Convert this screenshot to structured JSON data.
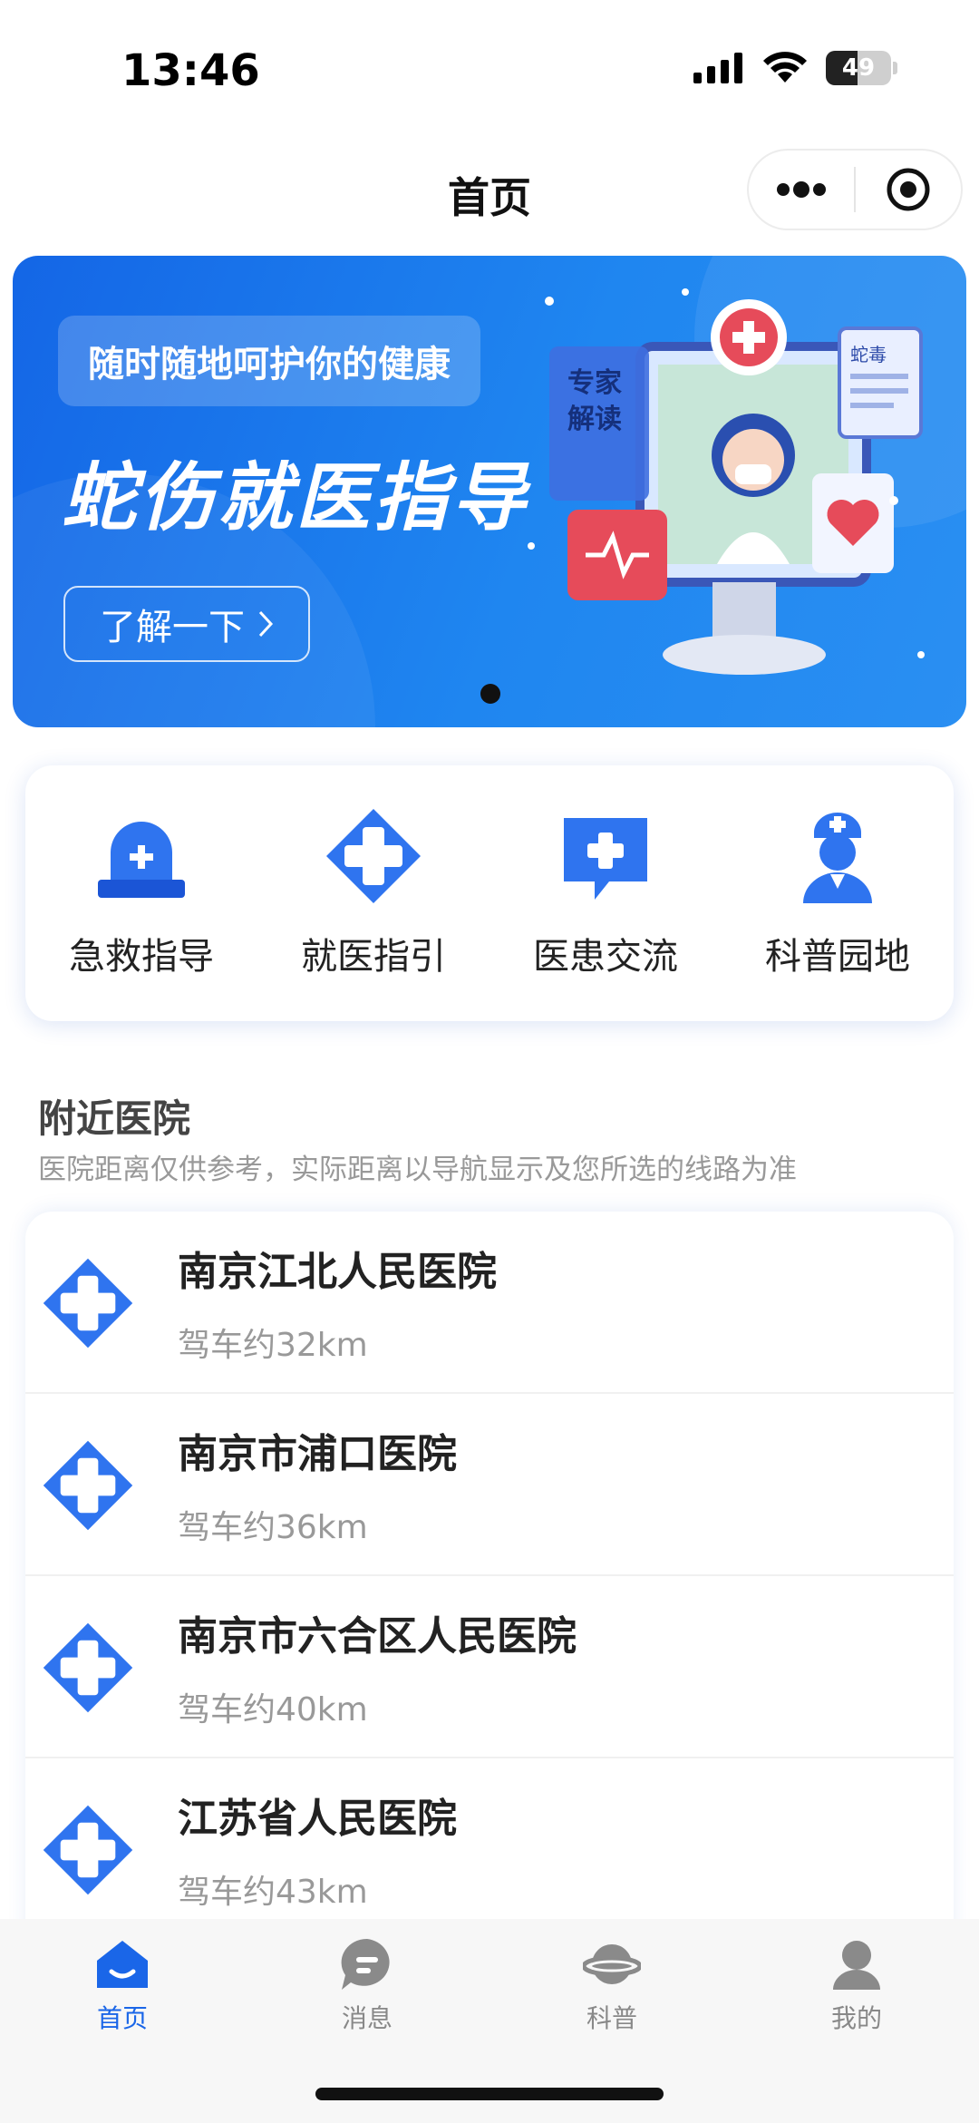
{
  "status": {
    "time": "13:46",
    "battery_level": "49",
    "battery_fraction": 0.49
  },
  "nav": {
    "title": "首页",
    "more_icon": "more-dots-icon",
    "close_icon": "target-circle-icon"
  },
  "banner": {
    "tag": "随时随地呵护你的健康",
    "title": "蛇伤就医指导",
    "button": "了解一下",
    "illustration_labels": [
      "专家",
      "解读",
      "蛇毒"
    ],
    "active_dot": 1,
    "colors": {
      "start": "#1466e6",
      "end": "#2a8ff2"
    }
  },
  "quick": [
    {
      "label": "急救指导",
      "icon": "alarm-light-icon"
    },
    {
      "label": "就医指引",
      "icon": "medical-cross-icon"
    },
    {
      "label": "医患交流",
      "icon": "chat-cross-icon"
    },
    {
      "label": "科普园地",
      "icon": "doctor-icon"
    }
  ],
  "nearby": {
    "title": "附近医院",
    "subtitle": "医院距离仅供参考，实际距离以导航显示及您所选的线路为准",
    "hospitals": [
      {
        "name": "南京江北人民医院",
        "distance": "驾车约32km"
      },
      {
        "name": "南京市浦口医院",
        "distance": "驾车约36km"
      },
      {
        "name": "南京市六合区人民医院",
        "distance": "驾车约40km"
      },
      {
        "name": "江苏省人民医院",
        "distance": "驾车约43km"
      }
    ]
  },
  "tabs": [
    {
      "label": "首页",
      "icon": "home-icon",
      "active": true
    },
    {
      "label": "消息",
      "icon": "message-icon",
      "active": false
    },
    {
      "label": "科普",
      "icon": "planet-icon",
      "active": false
    },
    {
      "label": "我的",
      "icon": "user-icon",
      "active": false
    }
  ],
  "colors": {
    "accent": "#1a66e8",
    "icon_blue": "#2f74ef",
    "muted_text": "#999999"
  }
}
